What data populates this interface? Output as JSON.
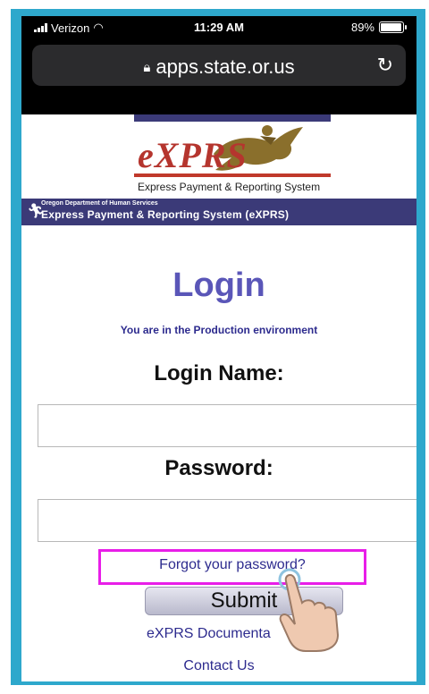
{
  "status_bar": {
    "carrier": "Verizon",
    "time": "11:29 AM",
    "battery": "89%",
    "battery_level": 0.89
  },
  "browser": {
    "url": "apps.state.or.us",
    "icons": [
      "lock-icon",
      "reload-icon"
    ]
  },
  "banner": {
    "logo": "eXPRS",
    "tagline": "Express Payment & Reporting System",
    "agency": "Oregon Department of Human Services",
    "system_name": "Express Payment & Reporting System (eXPRS)"
  },
  "login": {
    "title": "Login",
    "environment_note": "You are in the Production environment",
    "login_name_label": "Login Name:",
    "login_name_value": "",
    "password_label": "Password:",
    "password_value": "",
    "forgot_link": "Forgot your password?",
    "submit_label": "Submit",
    "documentation_link": "eXPRS Documenta",
    "contact_link": "Contact Us"
  },
  "colors": {
    "frame": "#2ea8cc",
    "title": "#5a56b8",
    "link": "#2d2b8e",
    "highlight": "#e81ee8",
    "band": "#3b3a78"
  }
}
